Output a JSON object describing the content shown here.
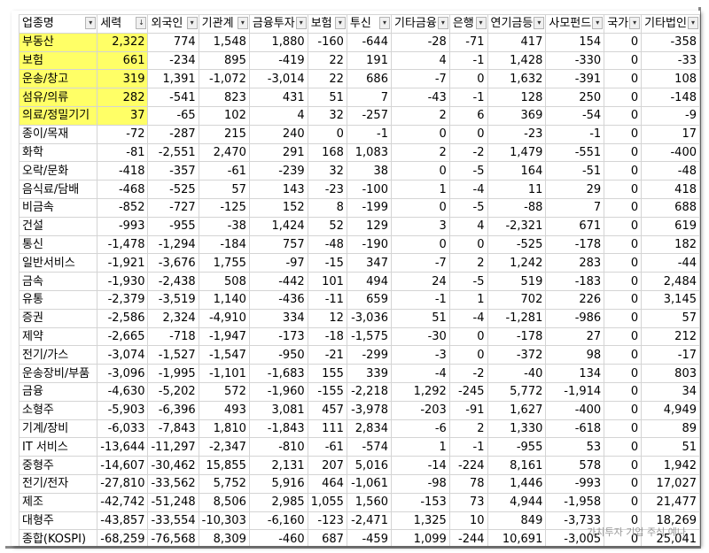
{
  "headers": [
    "업종명",
    "세력",
    "외국인",
    "기관계",
    "금융투자",
    "보험",
    "투신",
    "기타금융",
    "은행",
    "연기금등",
    "사모펀드",
    "국가",
    "기타법인"
  ],
  "filter_icons": [
    "▾",
    "↓",
    "▾",
    "▾",
    "▾",
    "▾",
    "▾",
    "▾",
    "▾",
    "▾",
    "▾",
    "▾",
    "▾"
  ],
  "highlight_color": "#ffff66",
  "rows": [
    {
      "cells": [
        "부동산",
        "2,322",
        "774",
        "1,548",
        "1,880",
        "-160",
        "-644",
        "-28",
        "-71",
        "417",
        "154",
        "0",
        "-358"
      ],
      "hl": true
    },
    {
      "cells": [
        "보험",
        "661",
        "-234",
        "895",
        "-419",
        "22",
        "191",
        "4",
        "-1",
        "1,428",
        "-330",
        "0",
        "-33"
      ],
      "hl": true
    },
    {
      "cells": [
        "운송/창고",
        "319",
        "1,391",
        "-1,072",
        "-3,014",
        "22",
        "686",
        "-7",
        "0",
        "1,632",
        "-391",
        "0",
        "108"
      ],
      "hl": true
    },
    {
      "cells": [
        "섬유/의류",
        "282",
        "-541",
        "823",
        "431",
        "51",
        "7",
        "-43",
        "-1",
        "128",
        "250",
        "0",
        "-148"
      ],
      "hl": true
    },
    {
      "cells": [
        "의료/정밀기기",
        "37",
        "-65",
        "102",
        "4",
        "32",
        "-257",
        "2",
        "6",
        "369",
        "-54",
        "0",
        "-9"
      ],
      "hl": true
    },
    {
      "cells": [
        "종이/목재",
        "-72",
        "-287",
        "215",
        "240",
        "0",
        "-1",
        "0",
        "0",
        "-23",
        "-1",
        "0",
        "17"
      ],
      "hl": false
    },
    {
      "cells": [
        "화학",
        "-81",
        "-2,551",
        "2,470",
        "291",
        "168",
        "1,083",
        "2",
        "-2",
        "1,479",
        "-551",
        "0",
        "-400"
      ],
      "hl": false
    },
    {
      "cells": [
        "오락/문화",
        "-418",
        "-357",
        "-61",
        "-239",
        "32",
        "38",
        "0",
        "-5",
        "164",
        "-51",
        "0",
        "-48"
      ],
      "hl": false
    },
    {
      "cells": [
        "음식료/담배",
        "-468",
        "-525",
        "57",
        "143",
        "-23",
        "-100",
        "1",
        "-4",
        "11",
        "29",
        "0",
        "418"
      ],
      "hl": false
    },
    {
      "cells": [
        "비금속",
        "-852",
        "-727",
        "-125",
        "152",
        "8",
        "-199",
        "0",
        "-5",
        "-88",
        "7",
        "0",
        "688"
      ],
      "hl": false
    },
    {
      "cells": [
        "건설",
        "-993",
        "-955",
        "-38",
        "1,424",
        "52",
        "129",
        "3",
        "4",
        "-2,321",
        "671",
        "0",
        "619"
      ],
      "hl": false
    },
    {
      "cells": [
        "통신",
        "-1,478",
        "-1,294",
        "-184",
        "757",
        "-48",
        "-190",
        "0",
        "0",
        "-525",
        "-178",
        "0",
        "182"
      ],
      "hl": false
    },
    {
      "cells": [
        "일반서비스",
        "-1,921",
        "-3,676",
        "1,755",
        "-97",
        "-15",
        "347",
        "-7",
        "2",
        "1,242",
        "283",
        "0",
        "-44"
      ],
      "hl": false
    },
    {
      "cells": [
        "금속",
        "-1,930",
        "-2,438",
        "508",
        "-442",
        "101",
        "494",
        "24",
        "-5",
        "519",
        "-183",
        "0",
        "2,484"
      ],
      "hl": false
    },
    {
      "cells": [
        "유통",
        "-2,379",
        "-3,519",
        "1,140",
        "-436",
        "-11",
        "659",
        "-1",
        "1",
        "702",
        "226",
        "0",
        "3,145"
      ],
      "hl": false
    },
    {
      "cells": [
        "증권",
        "-2,586",
        "2,324",
        "-4,910",
        "334",
        "12",
        "-3,036",
        "51",
        "-4",
        "-1,281",
        "-986",
        "0",
        "57"
      ],
      "hl": false
    },
    {
      "cells": [
        "제약",
        "-2,665",
        "-718",
        "-1,947",
        "-173",
        "-18",
        "-1,575",
        "-30",
        "0",
        "-178",
        "27",
        "0",
        "212"
      ],
      "hl": false
    },
    {
      "cells": [
        "전기/가스",
        "-3,074",
        "-1,527",
        "-1,547",
        "-950",
        "-21",
        "-299",
        "-3",
        "0",
        "-372",
        "98",
        "0",
        "-17"
      ],
      "hl": false
    },
    {
      "cells": [
        "운송장비/부품",
        "-3,096",
        "-1,995",
        "-1,101",
        "-1,683",
        "155",
        "339",
        "-4",
        "-2",
        "-40",
        "134",
        "0",
        "803"
      ],
      "hl": false
    },
    {
      "cells": [
        "금융",
        "-4,630",
        "-5,202",
        "572",
        "-1,960",
        "-155",
        "-2,218",
        "1,292",
        "-245",
        "5,772",
        "-1,914",
        "0",
        "34"
      ],
      "hl": false
    },
    {
      "cells": [
        "소형주",
        "-5,903",
        "-6,396",
        "493",
        "3,081",
        "457",
        "-3,978",
        "-203",
        "-91",
        "1,627",
        "-400",
        "0",
        "4,949"
      ],
      "hl": false
    },
    {
      "cells": [
        "기계/장비",
        "-6,033",
        "-7,843",
        "1,810",
        "-1,843",
        "111",
        "2,834",
        "-6",
        "2",
        "1,330",
        "-618",
        "0",
        "89"
      ],
      "hl": false
    },
    {
      "cells": [
        "IT 서비스",
        "-13,644",
        "-11,297",
        "-2,347",
        "-810",
        "-61",
        "-574",
        "1",
        "-1",
        "-955",
        "53",
        "0",
        "51"
      ],
      "hl": false
    },
    {
      "cells": [
        "중형주",
        "-14,607",
        "-30,462",
        "15,855",
        "2,131",
        "207",
        "5,016",
        "-14",
        "-224",
        "8,161",
        "578",
        "0",
        "1,942"
      ],
      "hl": false
    },
    {
      "cells": [
        "전기/전자",
        "-27,810",
        "-33,562",
        "5,752",
        "5,916",
        "464",
        "-1,061",
        "-98",
        "78",
        "1,446",
        "-993",
        "0",
        "17,027"
      ],
      "hl": false
    },
    {
      "cells": [
        "제조",
        "-42,742",
        "-51,248",
        "8,506",
        "2,985",
        "1,055",
        "1,560",
        "-153",
        "73",
        "4,944",
        "-1,958",
        "0",
        "21,477"
      ],
      "hl": false
    },
    {
      "cells": [
        "대형주",
        "-43,857",
        "-33,554",
        "-10,303",
        "-6,160",
        "-123",
        "-2,471",
        "1,325",
        "10",
        "849",
        "-3,733",
        "0",
        "18,269"
      ],
      "hl": false
    },
    {
      "cells": [
        "종합(KOSPI)",
        "-68,259",
        "-76,568",
        "8,309",
        "-460",
        "687",
        "-459",
        "1,099",
        "-244",
        "10,691",
        "-3,005",
        "0",
        "25,041"
      ],
      "hl": false
    }
  ],
  "watermark": "가치투자 기업 주식 예나"
}
